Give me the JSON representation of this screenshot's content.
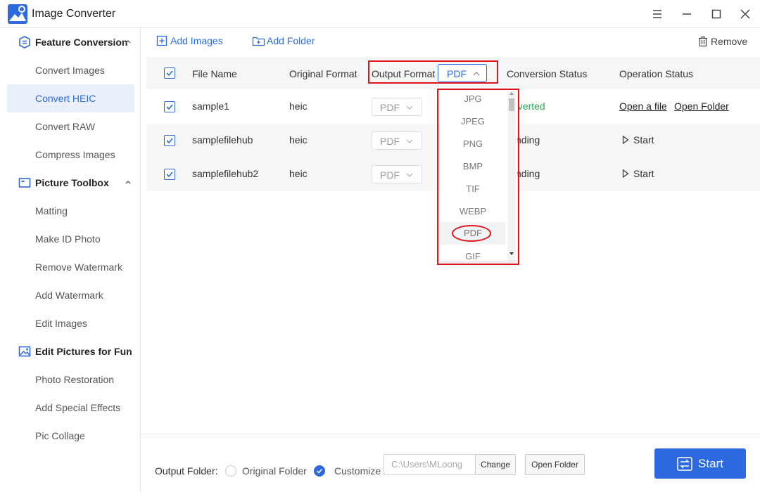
{
  "app": {
    "title": "Image Converter"
  },
  "sidebar": {
    "sections": [
      {
        "label": "Feature Conversion",
        "icon": "feature-conversion-icon",
        "items": [
          "Convert Images",
          "Convert HEIC",
          "Convert RAW",
          "Compress Images"
        ]
      },
      {
        "label": "Picture Toolbox",
        "icon": "picture-toolbox-icon",
        "items": [
          "Matting",
          "Make ID Photo",
          "Remove Watermark",
          "Add Watermark",
          "Edit Images"
        ]
      },
      {
        "label": "Edit Pictures for Fun",
        "icon": "edit-pictures-icon",
        "items": [
          "Photo Restoration",
          "Add Special Effects",
          "Pic Collage"
        ]
      }
    ],
    "active_item": "Convert HEIC"
  },
  "toolbar": {
    "add_images": "Add Images",
    "add_folder": "Add Folder",
    "remove": "Remove"
  },
  "table": {
    "headers": {
      "file_name": "File Name",
      "original_format": "Original Format",
      "output_format": "Output Format",
      "output_format_value": "PDF",
      "conversion_status": "Conversion Status",
      "operation_status": "Operation Status"
    },
    "rows": [
      {
        "name": "sample1",
        "original": "heic",
        "output": "PDF",
        "status": "nverted",
        "op1": "Open a file",
        "op2": "Open Folder"
      },
      {
        "name": "samplefilehub",
        "original": "heic",
        "output": "PDF",
        "status": "nding",
        "op1": "Start"
      },
      {
        "name": "samplefilehub2",
        "original": "heic",
        "output": "PDF",
        "status": "nding",
        "op1": "Start"
      }
    ]
  },
  "dropdown": {
    "options": [
      "JPG",
      "JPEG",
      "PNG",
      "BMP",
      "TIF",
      "WEBP",
      "PDF",
      "GIF"
    ],
    "selected": "PDF"
  },
  "footer": {
    "output_folder_label": "Output Folder:",
    "original_folder": "Original Folder",
    "customize": "Customize",
    "path": "C:\\Users\\MLoong",
    "change": "Change",
    "open_folder": "Open Folder",
    "start": "Start"
  },
  "colors": {
    "accent": "#2d6ae0",
    "highlight": "#e0151b",
    "success": "#2fa55b"
  }
}
